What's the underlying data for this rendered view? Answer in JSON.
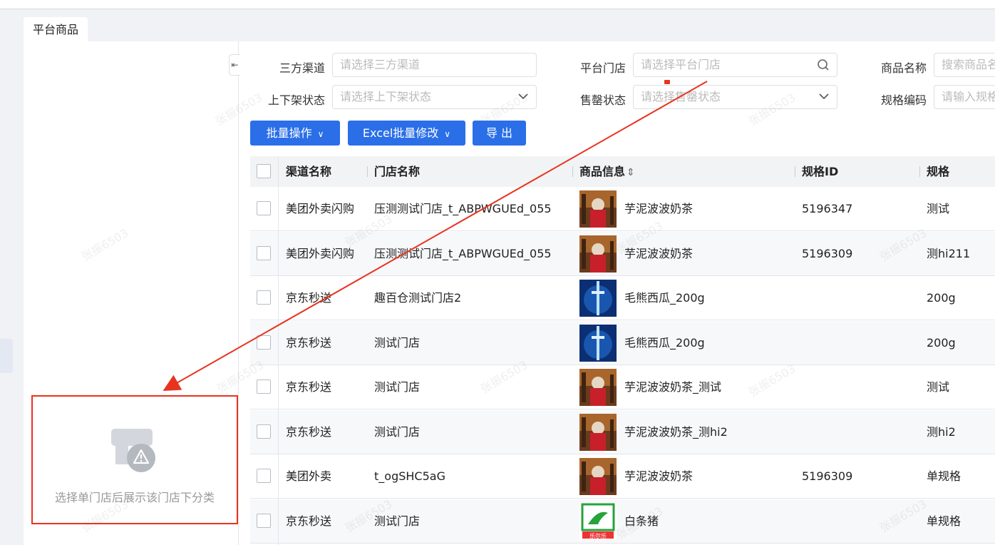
{
  "tab": {
    "label": "平台商品"
  },
  "sidebar": {
    "collapse_icon": "collapse-left-icon",
    "empty_icon": "store-warning-icon",
    "empty_text": "选择单门店后展示该门店下分类"
  },
  "filters": {
    "channel": {
      "label": "三方渠道",
      "placeholder": "请选择三方渠道"
    },
    "store": {
      "label": "平台门店",
      "placeholder": "请选择平台门店",
      "icon": "search-icon"
    },
    "product_name": {
      "label": "商品名称",
      "placeholder": "搜索商品名"
    },
    "shelf_status": {
      "label": "上下架状态",
      "placeholder": "请选择上下架状态",
      "icon": "chevron-down-icon"
    },
    "soldout_status": {
      "label": "售罄状态",
      "placeholder": "请选择售罄状态",
      "icon": "chevron-down-icon"
    },
    "spec_code": {
      "label": "规格编码",
      "placeholder": "请输入规格"
    }
  },
  "toolbar": {
    "batch_label": "批量操作",
    "excel_label": "Excel批量修改",
    "export_label": "导 出"
  },
  "table": {
    "columns": [
      "渠道名称",
      "门店名称",
      "商品信息",
      "规格ID",
      "规格"
    ],
    "sort_icon": "sort-icon",
    "rows": [
      {
        "channel": "美团外卖闪购",
        "store": "压测测试门店_t_ABPWGUEd_055",
        "thumb": "milk-tea",
        "product": "芋泥波波奶茶",
        "spec_id": "5196347",
        "spec": "测试"
      },
      {
        "channel": "美团外卖闪购",
        "store": "压测测试门店_t_ABPWGUEd_055",
        "thumb": "milk-tea",
        "product": "芋泥波波奶茶",
        "spec_id": "5196309",
        "spec": "测hi211"
      },
      {
        "channel": "京东秒送",
        "store": "趣百仓测试门店2",
        "thumb": "sword",
        "product": "毛熊西瓜_200g",
        "spec_id": "",
        "spec": "200g"
      },
      {
        "channel": "京东秒送",
        "store": "测试门店",
        "thumb": "sword",
        "product": "毛熊西瓜_200g",
        "spec_id": "",
        "spec": "200g"
      },
      {
        "channel": "京东秒送",
        "store": "测试门店",
        "thumb": "milk-tea",
        "product": "芋泥波波奶茶_测试",
        "spec_id": "",
        "spec": "测试"
      },
      {
        "channel": "京东秒送",
        "store": "测试门店",
        "thumb": "milk-tea",
        "product": "芋泥波波奶茶_测hi2",
        "spec_id": "",
        "spec": "测hi2"
      },
      {
        "channel": "美团外卖",
        "store": "t_ogSHC5aG",
        "thumb": "milk-tea",
        "product": "芋泥波波奶茶",
        "spec_id": "5196309",
        "spec": "单规格"
      },
      {
        "channel": "京东秒送",
        "store": "测试门店",
        "thumb": "lele-logo",
        "product": "白条猪",
        "spec_id": "",
        "spec": "单规格"
      }
    ]
  },
  "logo_text": "乐尔乐",
  "watermark": "张振6503",
  "colors": {
    "primary": "#2a6fe8",
    "annotation": "#e8331f"
  }
}
